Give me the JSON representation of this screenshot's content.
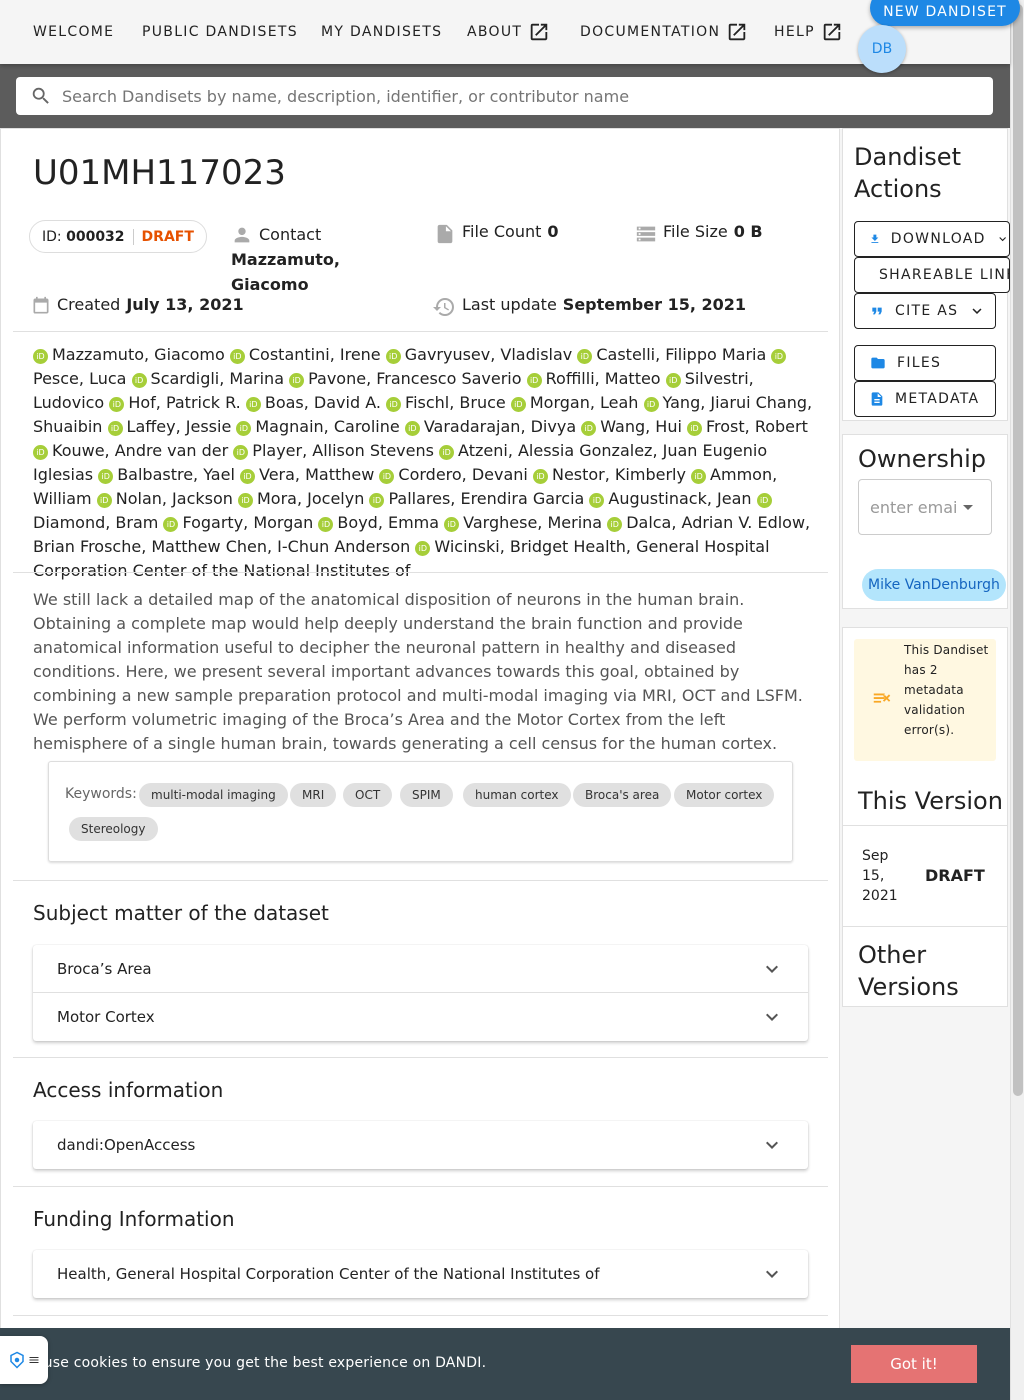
{
  "nav": {
    "welcome": "WELCOME",
    "public": "PUBLIC DANDISETS",
    "my": "MY DANDISETS",
    "about": "ABOUT",
    "docs": "DOCUMENTATION",
    "help": "HELP",
    "new_dandiset": "NEW DANDISET",
    "avatar": "DB"
  },
  "search": {
    "placeholder": "Search Dandisets by name, description, identifier, or contributor name"
  },
  "dandiset": {
    "title": "U01MH117023",
    "id_label": "ID:",
    "id": "000032",
    "status": "DRAFT",
    "contact_label": "Contact",
    "contact_name": "Mazzamuto, Giacomo",
    "file_count_label": "File Count",
    "file_count": "0",
    "file_size_label": "File Size",
    "file_size": "0 B",
    "created_label": "Created",
    "created": "July 13, 2021",
    "updated_label": "Last update",
    "updated": "September 15, 2021"
  },
  "contributors": [
    "Mazzamuto, Giacomo",
    "Costantini, Irene",
    "Gavryusev, Vladislav",
    "Castelli, Filippo Maria",
    "Pesce, Luca",
    "Scardigli, Marina",
    "Pavone, Francesco Saverio",
    "Roffilli, Matteo",
    "Silvestri, Ludovico",
    "Hof, Patrick R.",
    "Boas, David A.",
    "Fischl, Bruce",
    "Morgan, Leah",
    "Yang, Jiarui Chang, Shuaibin",
    "Laffey, Jessie",
    "Magnain, Caroline",
    "Varadarajan, Divya",
    "Wang, Hui",
    "Frost, Robert",
    "Kouwe, Andre van der",
    "Player, Allison Stevens",
    "Atzeni, Alessia Gonzalez, Juan Eugenio Iglesias",
    "Balbastre, Yael",
    "Vera, Matthew",
    "Cordero, Devani",
    "Nestor, Kimberly",
    "Ammon, William",
    "Nolan, Jackson",
    "Mora, Jocelyn",
    "Pallares, Erendira Garcia",
    "Augustinack, Jean",
    "Diamond, Bram",
    "Fogarty, Morgan",
    "Boyd, Emma",
    "Varghese, Merina",
    "Dalca, Adrian V. Edlow, Brian Frosche, Matthew Chen, I-Chun Anderson",
    "Wicinski, Bridget Health, General Hospital Corporation Center of the National Institutes of"
  ],
  "description": "We still lack a detailed map of the anatomical disposition of neurons in the human brain. Obtaining a complete map would help deeply understand the brain function and provide anatomical information useful to decipher the neuronal pattern in healthy and diseased conditions. Here, we present several important advances towards this goal, obtained by combining a new sample preparation protocol and multi-modal imaging via MRI, OCT and LSFM. We perform volumetric imaging of the Broca’s Area and the Motor Cortex from the left hemisphere of a single human brain, towards generating a cell census for the human cortex.",
  "keywords_label": "Keywords:",
  "keywords": [
    "multi-modal imaging",
    "MRI",
    "OCT",
    "SPIM",
    "human cortex",
    "Broca's area",
    "Motor cortex",
    "Stereology"
  ],
  "sections": {
    "subject": {
      "title": "Subject matter of the dataset",
      "items": [
        "Broca’s Area",
        "Motor Cortex"
      ]
    },
    "access": {
      "title": "Access information",
      "items": [
        "dandi:OpenAccess"
      ]
    },
    "funding": {
      "title": "Funding Information",
      "items": [
        "Health, General Hospital Corporation Center of the National Institutes of"
      ]
    }
  },
  "sidebar": {
    "actions_title": "Dandiset Actions",
    "download": "DOWNLOAD",
    "share": "SHAREABLE LINK",
    "cite": "CITE AS",
    "files": "FILES",
    "metadata": "METADATA",
    "ownership_title": "Ownership",
    "owner_input_placeholder": "enter email",
    "owner": "Mike VanDenburgh",
    "validation_warning": "This Dandiset has 2 metadata validation error(s).",
    "this_version_title": "This Version",
    "version_date": "Sep 15, 2021",
    "version_status": "DRAFT",
    "other_versions_title": "Other Versions"
  },
  "cookie": {
    "text": "We use cookies to ensure you get the best experience on DANDI.",
    "button": "Got it!"
  },
  "colors": {
    "accent": "#1e88e5",
    "draft": "#e65100",
    "orcid": "#a6ce39",
    "cookie_bg": "#37474f",
    "cookie_btn": "#e57373",
    "warning_bg": "#fff8e1",
    "warning_icon": "#f9a825"
  }
}
